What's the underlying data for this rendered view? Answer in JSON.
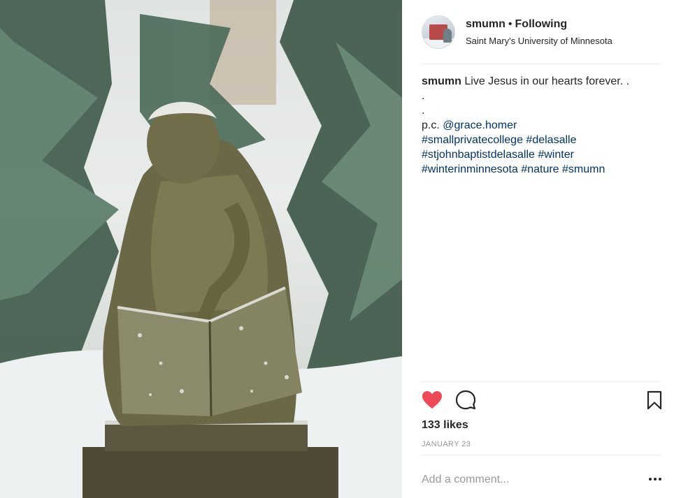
{
  "post": {
    "username": "smumn",
    "follow_status": "Following",
    "separator": "•",
    "location": "Saint Mary's University of Minnesota"
  },
  "caption": {
    "username": "smumn",
    "text": "Live Jesus in our hearts forever. .",
    "dot1": ".",
    "dot2": ".",
    "credit_prefix": "p.c.",
    "mention": "@grace.homer",
    "hashtags": [
      "#smallprivatecollege",
      "#delasalle",
      "#stjohnbaptistdelasalle",
      "#winter",
      "#winterinminnesota",
      "#nature",
      "#smumn"
    ]
  },
  "actions": {
    "like_icon": "heart-filled-icon",
    "comment_icon": "comment-bubble-icon",
    "save_icon": "bookmark-icon"
  },
  "likes": "133 likes",
  "date": "JANUARY 23",
  "comment": {
    "placeholder": "Add a comment..."
  },
  "more_icon": "ellipsis-icon",
  "colors": {
    "heart": "#ed4956",
    "hashtag": "#003569",
    "muted": "#999999"
  }
}
